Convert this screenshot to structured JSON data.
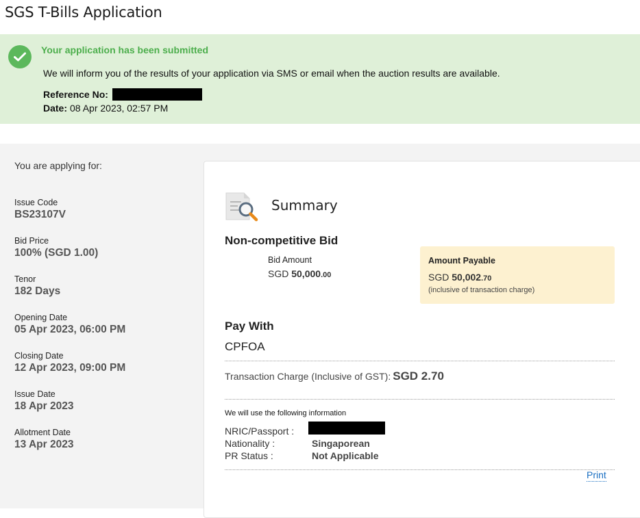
{
  "page": {
    "title": "SGS T-Bills Application"
  },
  "banner": {
    "title": "Your application has been submitted",
    "message": "We will inform you of the results of your application via SMS or email when the auction results are available.",
    "reference_label": "Reference No:",
    "date_label": "Date:",
    "date_value": "08 Apr 2023, 02:57 PM",
    "icon": "check-circle-icon",
    "accent_color": "#5cb85c",
    "background_color": "#dff0d8"
  },
  "sidebar": {
    "heading": "You are applying for:",
    "fields": [
      {
        "label": "Issue Code",
        "value": "BS23107V"
      },
      {
        "label": "Bid Price",
        "value": "100% (SGD 1.00)"
      },
      {
        "label": "Tenor",
        "value": "182 Days"
      },
      {
        "label": "Opening Date",
        "value": "05 Apr 2023, 06:00 PM"
      },
      {
        "label": "Closing Date",
        "value": "12 Apr 2023, 09:00 PM"
      },
      {
        "label": "Issue Date",
        "value": "18 Apr 2023"
      },
      {
        "label": "Allotment Date",
        "value": "13 Apr 2023"
      }
    ]
  },
  "summary": {
    "title": "Summary",
    "icon": "document-search-icon",
    "bid_type": "Non-competitive Bid",
    "bid_amount_label": "Bid Amount",
    "bid_amount_currency": "SGD",
    "bid_amount_whole": "50,000",
    "bid_amount_decimal": ".00",
    "amount_payable": {
      "title": "Amount Payable",
      "currency": "SGD",
      "whole": "50,002",
      "decimal": ".70",
      "note": "(inclusive of transaction charge)",
      "background_color": "#fdf1d0"
    },
    "pay_with_label": "Pay With",
    "pay_with_value": "CPFOA",
    "transaction_charge_label": "Transaction Charge (Inclusive of GST):",
    "transaction_charge_value": "SGD 2.70",
    "info_heading": "We will use the following information",
    "info": {
      "nric_label": "NRIC/Passport :",
      "nationality_label": "Nationality :",
      "nationality_value": "Singaporean",
      "pr_status_label": "PR Status :",
      "pr_status_value": "Not Applicable"
    },
    "print_label": "Print",
    "link_color": "#1a6fc2"
  }
}
